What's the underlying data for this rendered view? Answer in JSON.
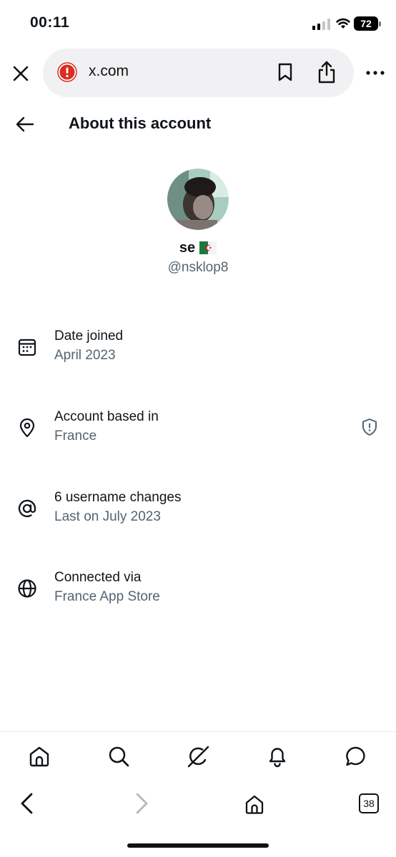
{
  "status_bar": {
    "time": "00:11",
    "battery": "72"
  },
  "browser": {
    "url": "x.com",
    "tab_count": "38"
  },
  "header": {
    "title": "About this account"
  },
  "profile": {
    "display_name": "se",
    "handle": "@nsklop8"
  },
  "info": [
    {
      "title": "Date joined",
      "value": "April 2023",
      "icon": "calendar-icon"
    },
    {
      "title": "Account based in",
      "value": "France",
      "icon": "location-pin-icon"
    },
    {
      "title": "6 username changes",
      "value": "Last on July 2023",
      "icon": "at-sign-icon"
    },
    {
      "title": "Connected via",
      "value": "France App Store",
      "icon": "globe-icon"
    }
  ],
  "colors": {
    "primary_text": "#0f1419",
    "secondary_text": "#536471",
    "warning": "#d92d20"
  }
}
